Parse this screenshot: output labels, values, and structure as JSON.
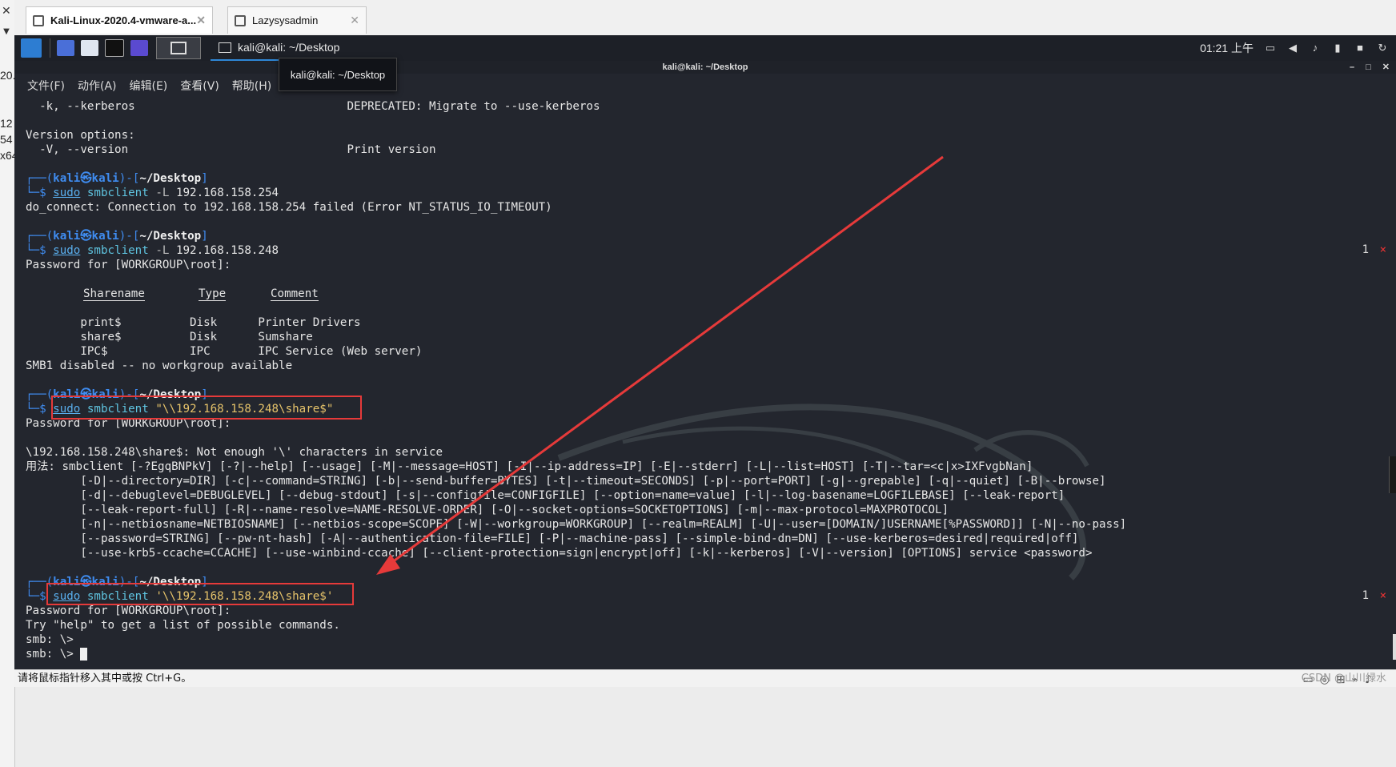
{
  "host": {
    "tabs": [
      {
        "label": "Kali-Linux-2020.4-vmware-a..."
      },
      {
        "label": "Lazysysadmin"
      }
    ],
    "left_fragments": [
      "20.",
      "12",
      "54",
      "x64"
    ]
  },
  "panel": {
    "task_label": "kali@kali: ~/Desktop",
    "clock": "01:21 上午"
  },
  "terminal": {
    "window_title": "kali@kali: ~/Desktop",
    "tooltip": "kali@kali: ~/Desktop",
    "menu": [
      "文件(F)",
      "动作(A)",
      "编辑(E)",
      "查看(V)",
      "帮助(H)"
    ],
    "lines": {
      "l1": "  -k, --kerberos                               DEPRECATED: Migrate to --use-kerberos",
      "l2": "",
      "l3": "Version options:",
      "l4": "  -V, --version                                Print version",
      "p1_user": "kali",
      "p1_host": "kali",
      "p1_dir": "~/Desktop",
      "c1_sudo": "sudo",
      "c1_cmd": " smbclient ",
      "c1_flag": "-L",
      "c1_arg": " 192.168.158.254",
      "l7": "do_connect: Connection to 192.168.158.254 failed (Error NT_STATUS_IO_TIMEOUT)",
      "c2_arg": " 192.168.158.248",
      "l10": "Password for [WORKGROUP\\root]:",
      "h_share": "Sharename",
      "h_type": "Type",
      "h_comment": "Comment",
      "r1": "        print$          Disk      Printer Drivers",
      "r2": "        share$          Disk      Sumshare",
      "r3": "        IPC$            IPC       IPC Service (Web server)",
      "l17": "SMB1 disabled -- no workgroup available",
      "c3_arg": "\"\\\\192.168.158.248\\share$\"",
      "l20": "Password for [WORKGROUP\\root]:",
      "l22": "\\192.168.158.248\\share$: Not enough '\\' characters in service",
      "l23": "用法: smbclient [-?EgqBNPkV] [-?|--help] [--usage] [-M|--message=HOST] [-I|--ip-address=IP] [-E|--stderr] [-L|--list=HOST] [-T|--tar=<c|x>IXFvgbNan]",
      "l24": "        [-D|--directory=DIR] [-c|--command=STRING] [-b|--send-buffer=BYTES] [-t|--timeout=SECONDS] [-p|--port=PORT] [-g|--grepable] [-q|--quiet] [-B|--browse]",
      "l25": "        [-d|--debuglevel=DEBUGLEVEL] [--debug-stdout] [-s|--configfile=CONFIGFILE] [--option=name=value] [-l|--log-basename=LOGFILEBASE] [--leak-report]",
      "l26": "        [--leak-report-full] [-R|--name-resolve=NAME-RESOLVE-ORDER] [-O|--socket-options=SOCKETOPTIONS] [-m|--max-protocol=MAXPROTOCOL]",
      "l27": "        [-n|--netbiosname=NETBIOSNAME] [--netbios-scope=SCOPE] [-W|--workgroup=WORKGROUP] [--realm=REALM] [-U|--user=[DOMAIN/]USERNAME[%PASSWORD]] [-N|--no-pass]",
      "l28": "        [--password=STRING] [--pw-nt-hash] [-A|--authentication-file=FILE] [-P|--machine-pass] [--simple-bind-dn=DN] [--use-kerberos=desired|required|off]",
      "l29": "        [--use-krb5-ccache=CCACHE] [--use-winbind-ccache] [--client-protection=sign|encrypt|off] [-k|--kerberos] [-V|--version] [OPTIONS] service <password>",
      "c4_arg": "'\\\\192.168.158.248\\share$'",
      "l33": "Password for [WORKGROUP\\root]:",
      "l34": "Try \"help\" to get a list of possible commands.",
      "l35": "smb: \\>",
      "l36": "smb: \\> "
    },
    "status_code_1": "1",
    "status_code_2": "1",
    "status_x": "×"
  },
  "vm_status": {
    "hint": "请将鼠标指针移入其中或按 Ctrl+G。",
    "watermark": "CSDN @山川绿水"
  },
  "colors": {
    "terminal_bg": "#23262e",
    "prompt_blue": "#3f8cf0",
    "annotation_red": "#e63a3a"
  }
}
